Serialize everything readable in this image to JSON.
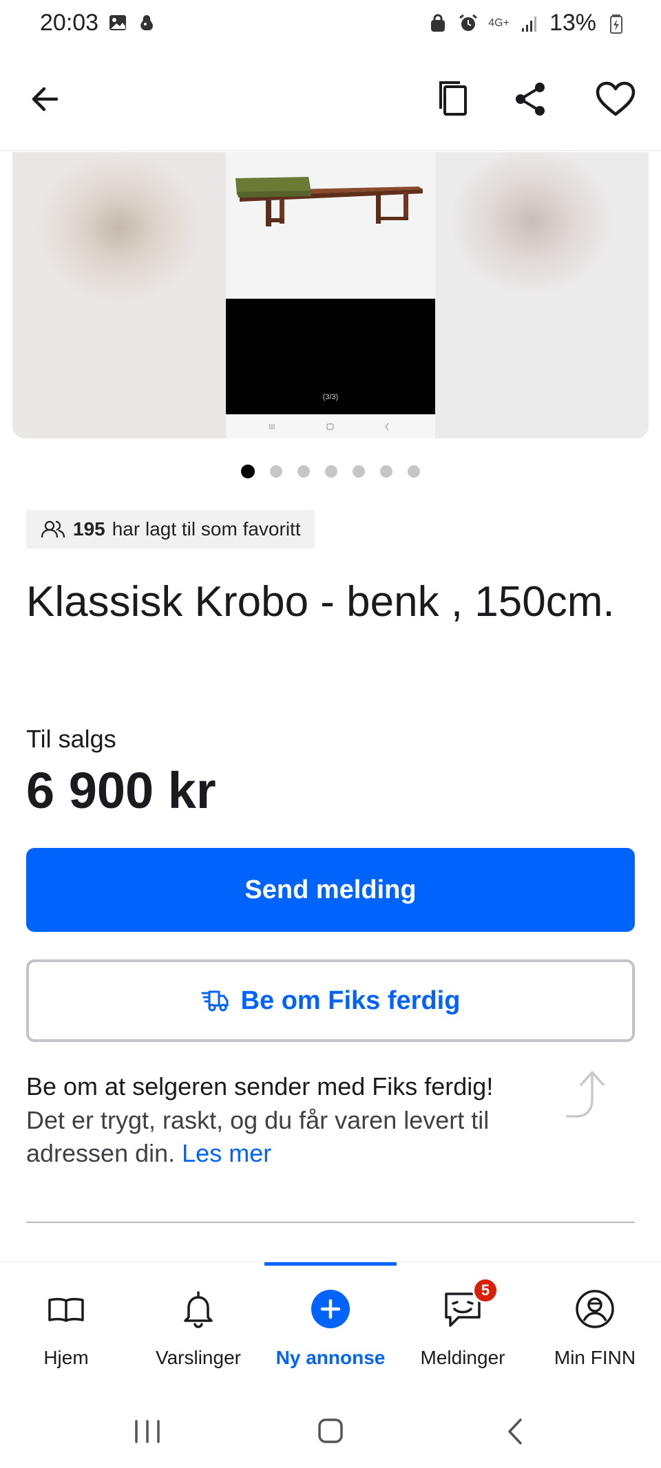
{
  "status_bar": {
    "time": "20:03",
    "battery": "13%",
    "network": "4G+"
  },
  "app_bar": {
    "icons": [
      "arrow-left-icon",
      "copy-icon",
      "share-icon",
      "heart-icon"
    ]
  },
  "gallery": {
    "counter": "(3/3)",
    "total_images": 7,
    "active_index": 0
  },
  "listing": {
    "favorites_count": "195",
    "favorites_text": "har lagt til som favoritt",
    "title": "Klassisk Krobo - benk , 150cm.",
    "sale_label": "Til salgs",
    "price": "6 900 kr"
  },
  "actions": {
    "send_message": "Send melding",
    "fiks_ferdig": "Be om Fiks ferdig"
  },
  "info": {
    "heading": "Be om at selgeren sender med Fiks ferdig!",
    "body": "Det er trygt, raskt, og du får varen levert til adressen din.",
    "link": "Les mer"
  },
  "bottom_nav": {
    "items": [
      {
        "label": "Hjem",
        "icon": "book-icon"
      },
      {
        "label": "Varslinger",
        "icon": "bell-icon"
      },
      {
        "label": "Ny annonse",
        "icon": "plus-circle-icon"
      },
      {
        "label": "Meldinger",
        "icon": "chat-icon",
        "badge": "5"
      },
      {
        "label": "Min FINN",
        "icon": "profile-icon"
      }
    ],
    "active": "Ny annonse"
  },
  "colors": {
    "accent": "#0063fb",
    "badge": "#d91f0a"
  }
}
